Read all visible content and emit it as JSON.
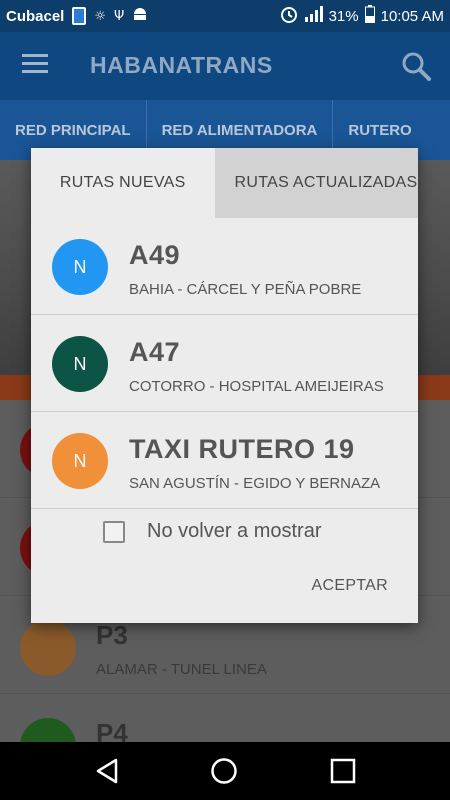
{
  "status_bar": {
    "carrier": "Cubacel",
    "battery": "31%",
    "time": "10:05 AM"
  },
  "app_bar": {
    "title": "HABANATRANS"
  },
  "tabs": [
    {
      "label": "RED PRINCIPAL"
    },
    {
      "label": "RED ALIMENTADORA"
    },
    {
      "label": "RUTERO"
    }
  ],
  "background_list": [
    {
      "code": "P3",
      "desc": "ALAMAR - TUNEL LINEA",
      "color": "#8a5a2a"
    },
    {
      "code": "P4",
      "desc": "",
      "color": "#1f5a1f"
    }
  ],
  "dialog": {
    "tabs": [
      {
        "label": "RUTAS NUEVAS",
        "active": true
      },
      {
        "label": "RUTAS ACTUALIZADAS",
        "active": false
      }
    ],
    "routes": [
      {
        "badge": "N",
        "code": "A49",
        "desc": "BAHIA - CÁRCEL Y PEÑA POBRE",
        "color": "#2196f3"
      },
      {
        "badge": "N",
        "code": "A47",
        "desc": "COTORRO - HOSPITAL AMEIJEIRAS",
        "color": "#0b5446"
      },
      {
        "badge": "N",
        "code": "TAXI RUTERO 19",
        "desc": "SAN AGUSTÍN - EGIDO Y BERNAZA",
        "color": "#f09038"
      }
    ],
    "checkbox_label": "No volver a mostrar",
    "checkbox_checked": false,
    "accept_label": "ACEPTAR"
  },
  "colors": {
    "status_bar": "#0d3d6b",
    "app_bar": "#0f4880",
    "tab_bar": "#1a5596",
    "dialog_bg": "#ececec"
  }
}
